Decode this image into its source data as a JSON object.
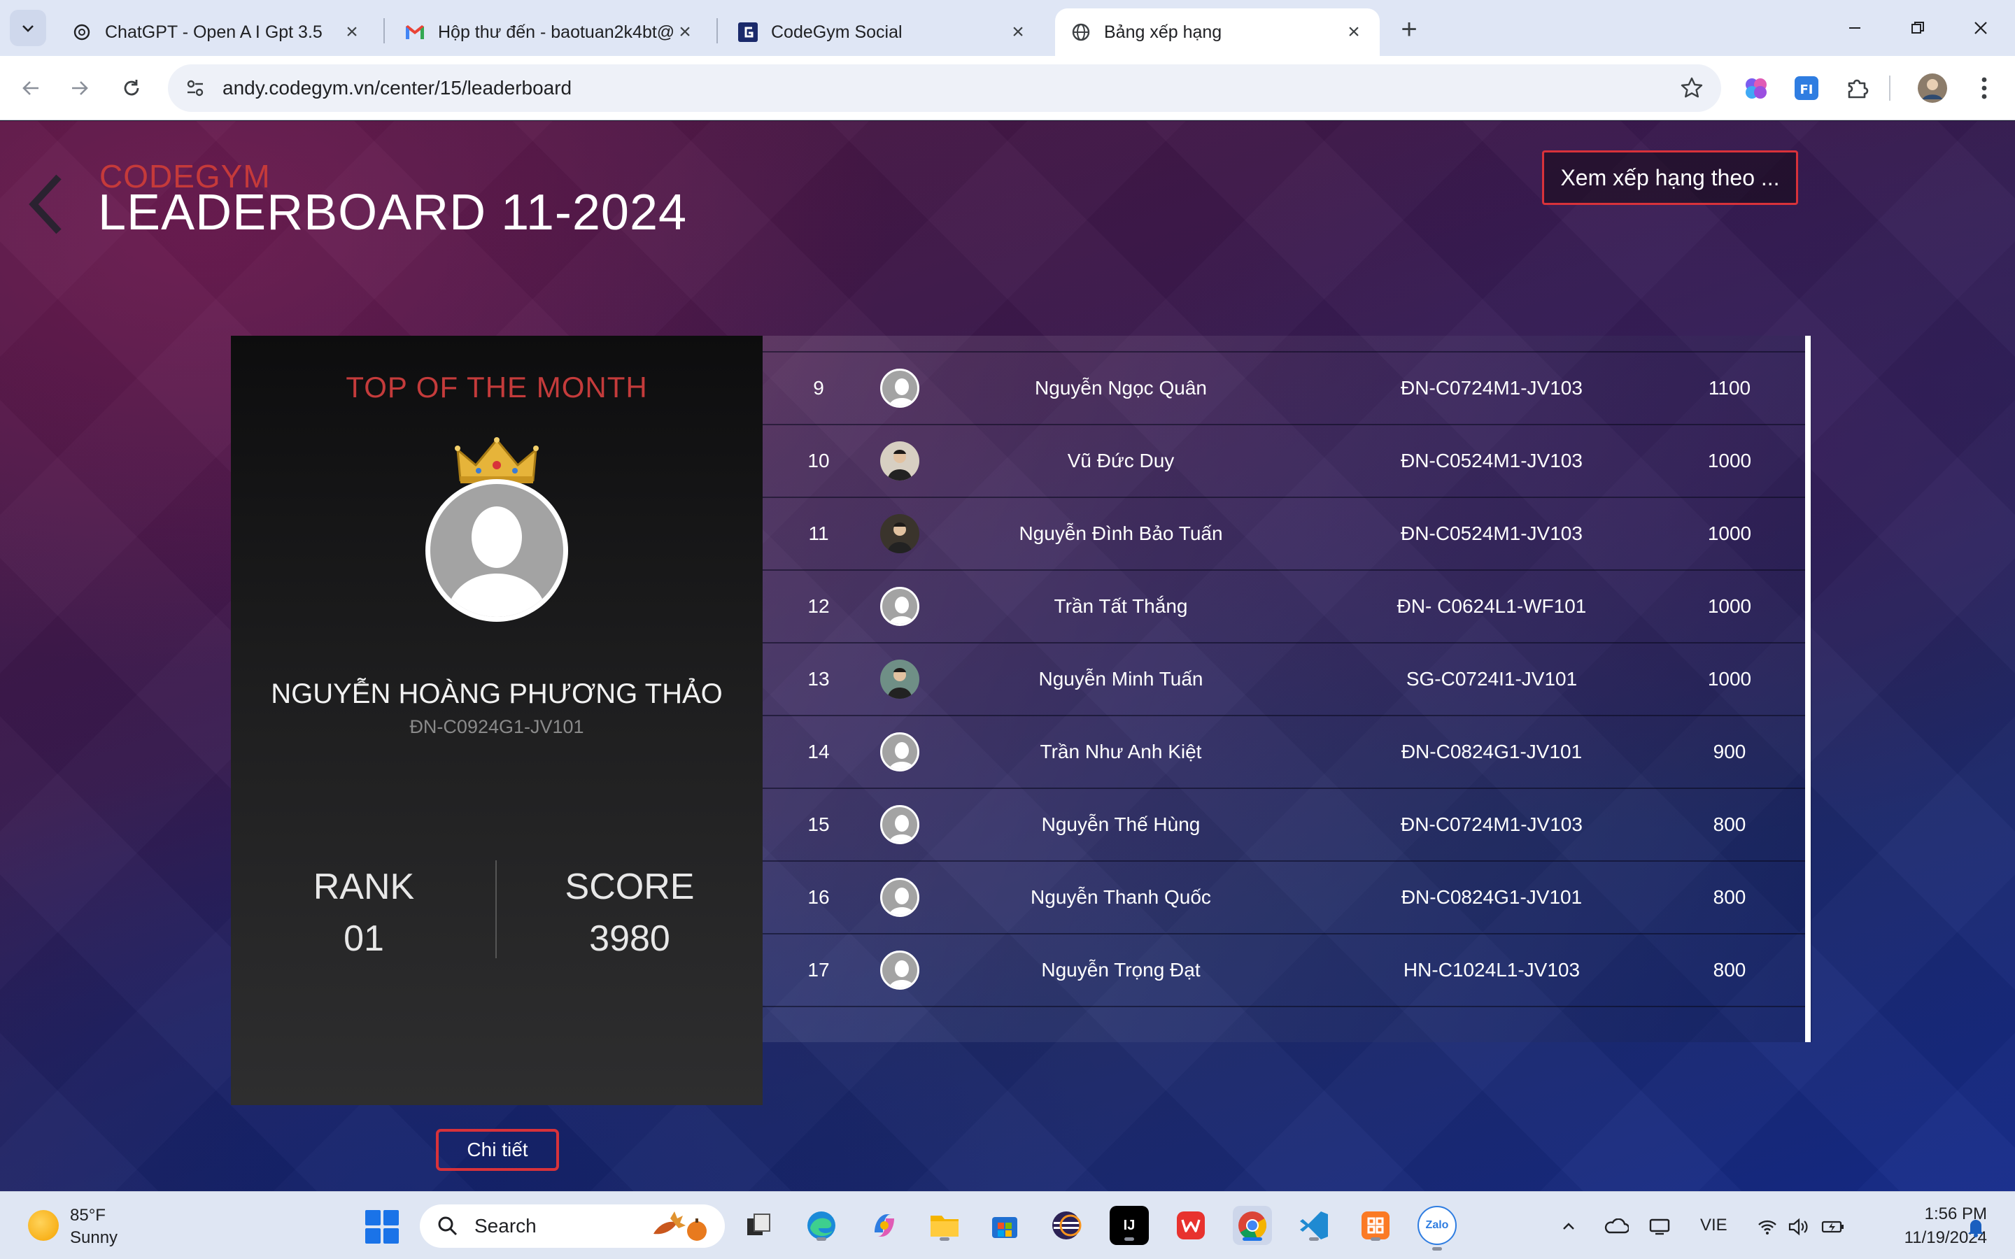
{
  "browser": {
    "tabs": [
      {
        "title": "ChatGPT - Open A I Gpt 3.5",
        "icon": "openai-icon",
        "active": false
      },
      {
        "title": "Hộp thư đến - baotuan2k4bt@",
        "icon": "gmail-icon",
        "active": false
      },
      {
        "title": "CodeGym Social",
        "icon": "codegym-icon",
        "active": false
      },
      {
        "title": "Bảng xếp hạng",
        "icon": "globe-icon",
        "active": true
      }
    ],
    "url": "andy.codegym.vn/center/15/leaderboard"
  },
  "header": {
    "brand": "CODEGYM",
    "title": "LEADERBOARD 11-2024",
    "rank_by_button": "Xem xếp hạng theo ..."
  },
  "top_card": {
    "title": "TOP OF THE MONTH",
    "name": "NGUYỄN HOÀNG PHƯƠNG THẢO",
    "class": "ĐN-C0924G1-JV101",
    "rank_label": "RANK",
    "rank_value": "01",
    "score_label": "SCORE",
    "score_value": "3980",
    "detail_button": "Chi tiết"
  },
  "leaderboard": {
    "rows": [
      {
        "rank": "9",
        "name": "Nguyễn Ngọc Quân",
        "class": "ĐN-C0724M1-JV103",
        "score": "1100",
        "avatar": "default"
      },
      {
        "rank": "10",
        "name": "Vũ Đức Duy",
        "class": "ĐN-C0524M1-JV103",
        "score": "1000",
        "avatar": "photo"
      },
      {
        "rank": "11",
        "name": "Nguyễn Đình Bảo Tuấn",
        "class": "ĐN-C0524M1-JV103",
        "score": "1000",
        "avatar": "dark"
      },
      {
        "rank": "12",
        "name": "Trần Tất Thắng",
        "class": "ĐN- C0624L1-WF101",
        "score": "1000",
        "avatar": "default"
      },
      {
        "rank": "13",
        "name": "Nguyễn Minh Tuấn",
        "class": "SG-C0724I1-JV101",
        "score": "1000",
        "avatar": "green"
      },
      {
        "rank": "14",
        "name": "Trần Như Anh Kiệt",
        "class": "ĐN-C0824G1-JV101",
        "score": "900",
        "avatar": "default"
      },
      {
        "rank": "15",
        "name": "Nguyễn Thế Hùng",
        "class": "ĐN-C0724M1-JV103",
        "score": "800",
        "avatar": "default"
      },
      {
        "rank": "16",
        "name": "Nguyễn Thanh Quốc",
        "class": "ĐN-C0824G1-JV101",
        "score": "800",
        "avatar": "default"
      },
      {
        "rank": "17",
        "name": "Nguyễn Trọng Đạt",
        "class": "HN-C1024L1-JV103",
        "score": "800",
        "avatar": "default"
      }
    ]
  },
  "taskbar": {
    "weather_temp": "85°F",
    "weather_desc": "Sunny",
    "search_label": "Search",
    "apps": [
      "file-explorer-icon",
      "edge-icon",
      "copilot-icon",
      "folder-icon",
      "store-icon",
      "eclipse-icon",
      "intellij-icon",
      "wps-icon",
      "chrome-icon",
      "vscode-icon",
      "xampp-icon",
      "zalo-icon"
    ],
    "zalo_label": "Zalo",
    "intellij_label": "IJ",
    "language": "VIE",
    "time": "1:56 PM",
    "date": "11/19/2024"
  },
  "colors": {
    "accent_red": "#d8323a",
    "brand_red": "#c53a3a",
    "chrome_blue": "#1a73e8"
  }
}
